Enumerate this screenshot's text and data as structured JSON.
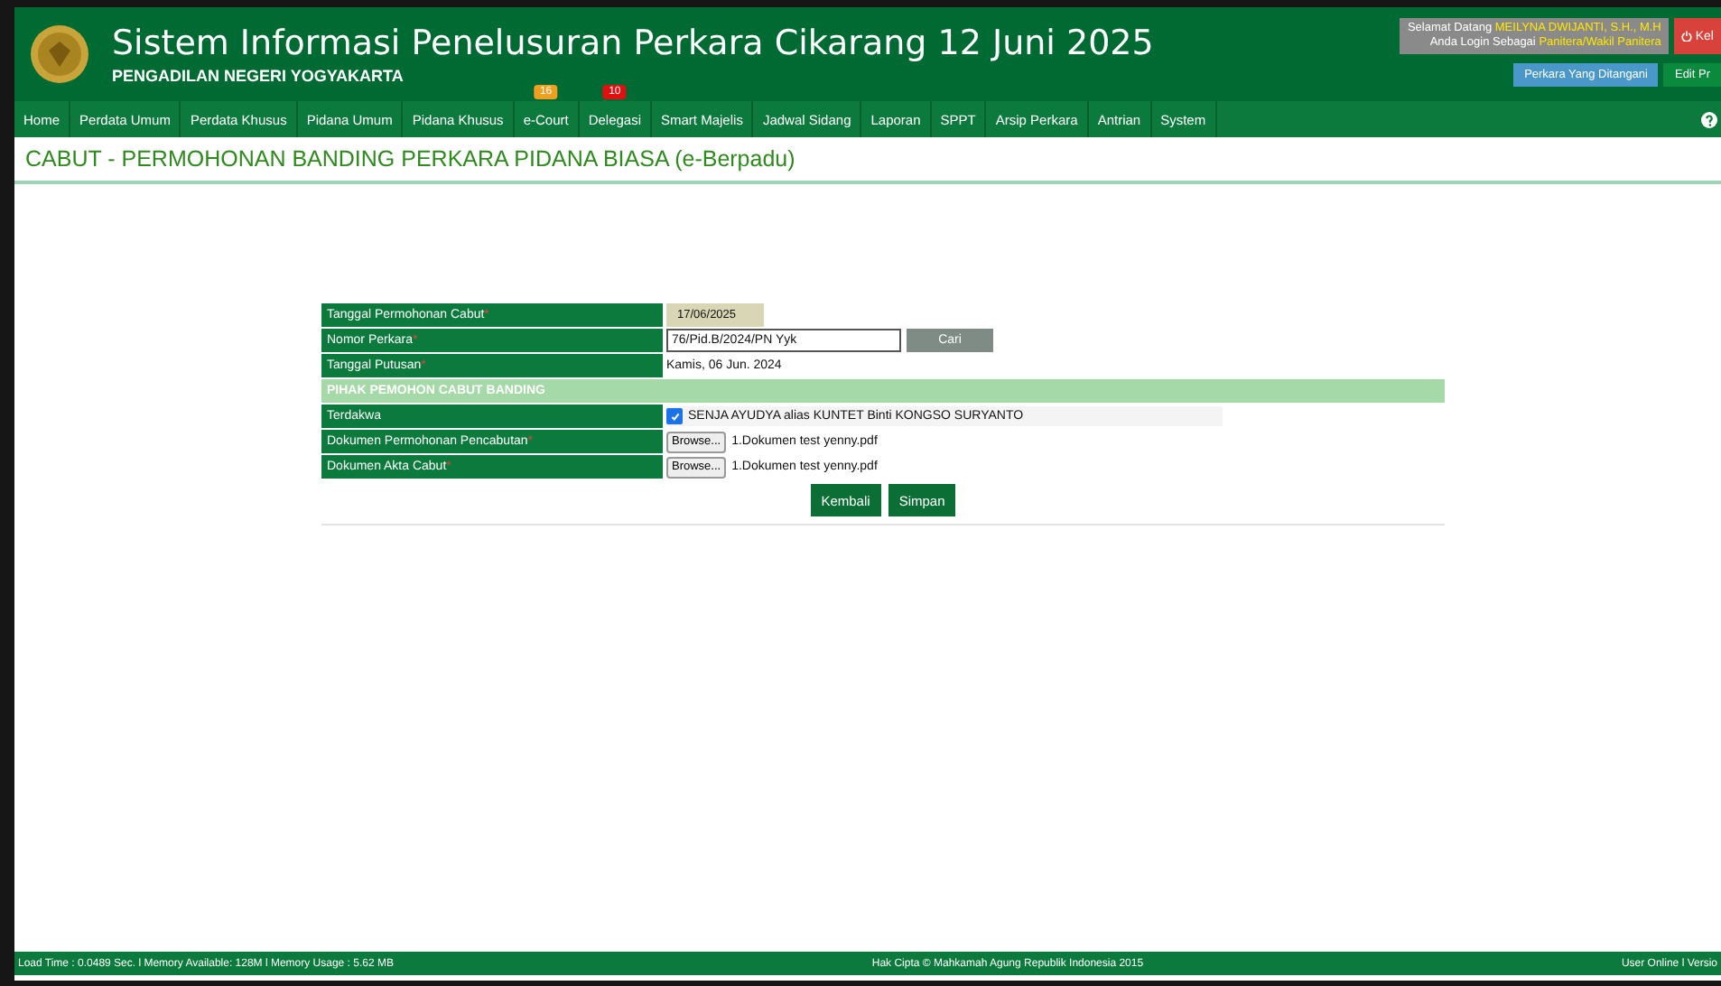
{
  "header": {
    "title": "Sistem Informasi Penelusuran Perkara Cikarang 12 Juni 2025",
    "subtitle": "PENGADILAN NEGERI YOGYAKARTA",
    "welcome": "Selamat Datang",
    "user": "MEILYNA DWIJANTI, S.H., M.H",
    "login_as": "Anda Login Sebagai",
    "role": "Panitera/Wakil Panitera",
    "logout": "Kel",
    "buttons": [
      {
        "label": "Perkara Yang Ditangani",
        "color": "#4a98c9"
      },
      {
        "label": "Edit Pr",
        "color": "#0a8a3c"
      }
    ]
  },
  "nav": [
    {
      "label": "Home"
    },
    {
      "label": "Perdata Umum"
    },
    {
      "label": "Perdata Khusus"
    },
    {
      "label": "Pidana Umum"
    },
    {
      "label": "Pidana Khusus"
    },
    {
      "label": "e-Court",
      "badge": "16",
      "color": "#f0a020"
    },
    {
      "label": "Delegasi",
      "badge": "10",
      "color": "#e01010"
    },
    {
      "label": "Smart Majelis"
    },
    {
      "label": "Jadwal Sidang"
    },
    {
      "label": "Laporan"
    },
    {
      "label": "SPPT"
    },
    {
      "label": "Arsip Perkara"
    },
    {
      "label": "Antrian"
    },
    {
      "label": "System"
    }
  ],
  "page_title": "CABUT - PERMOHONAN BANDING PERKARA PIDANA BIASA (e-Berpadu)",
  "form": [
    {
      "kind": "date",
      "label": "Tanggal Permohonan Cabut",
      "mark": "*",
      "value": "17/06/2025"
    },
    {
      "kind": "input",
      "label": "Nomor Perkara",
      "mark": "*",
      "value": "76/Pid.B/2024/PN Yyk",
      "button": "Cari"
    },
    {
      "kind": "text",
      "label": "Tanggal Putusan",
      "mark": "*",
      "value": "Kamis, 06 Jun. 2024"
    },
    {
      "kind": "section",
      "label": "PIHAK PEMOHON CABUT BANDING"
    },
    {
      "kind": "checkbox",
      "label": "Terdakwa",
      "value": "SENJA AYUDYA alias KUNTET Binti KONGSO SURYANTO",
      "checked": true
    },
    {
      "kind": "file",
      "label": "Dokumen Permohonan Pencabutan",
      "mark": "*",
      "button": "Browse...",
      "value": "1.Dokumen test yenny.pdf"
    },
    {
      "kind": "file",
      "label": "Dokumen Akta Cabut",
      "mark": "*",
      "button": "Browse...",
      "value": "1.Dokumen test yenny.pdf"
    }
  ],
  "actions": [
    "Kembali",
    "Simpan"
  ],
  "footer": {
    "left": "Load Time : 0.0489 Sec. l Memory Available: 128M l Memory Usage : 5.62 MB",
    "center": "Hak Cipta © Mahkamah Agung Republik Indonesia 2015",
    "right": "User Online l Versio"
  }
}
